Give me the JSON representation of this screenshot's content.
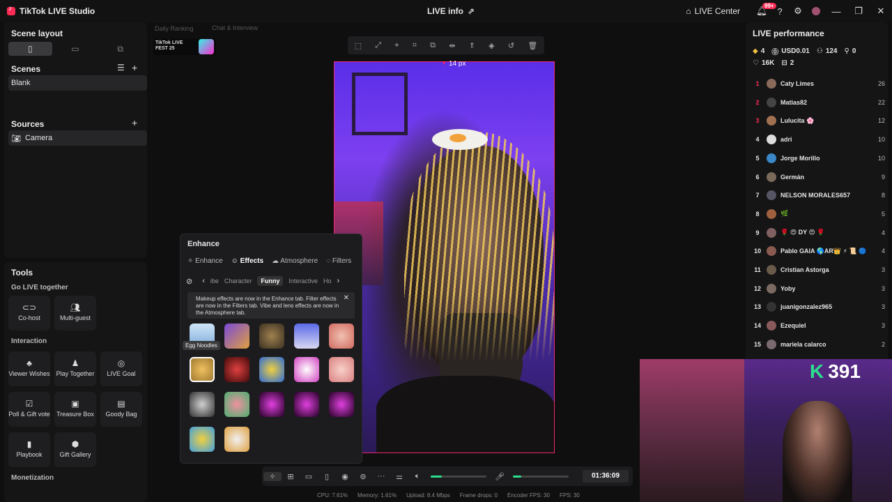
{
  "app": {
    "title": "TikTok LIVE Studio",
    "center_title": "LIVE info",
    "live_center_label": "LIVE Center",
    "notification_badge": "99+"
  },
  "left": {
    "scene_layout_label": "Scene layout",
    "scenes_label": "Scenes",
    "scenes": [
      "Blank"
    ],
    "sources_label": "Sources",
    "sources": [
      "Camera"
    ]
  },
  "tools": {
    "title": "Tools",
    "go_live_together": "Go LIVE together",
    "cohost": "Co-host",
    "multiguest": "Multi-guest",
    "interaction": "Interaction",
    "viewer_wishes": "Viewer Wishes",
    "play_together": "Play Together",
    "live_goal": "LIVE Goal",
    "poll_gift": "Poll & Gift vote",
    "treasure_box": "Treasure Box",
    "goody_bag": "Goody Bag",
    "playbook": "Playbook",
    "gift_gallery": "Gift Gallery",
    "monetization": "Monetization"
  },
  "stage": {
    "overlay_daily": "Daily Ranking",
    "overlay_chat": "Chat & Interview",
    "fest_logo": "TikTok LIVE FEST 25",
    "px_label": "14 px"
  },
  "effects": {
    "title": "Enhance",
    "tabs": [
      "Enhance",
      "Effects",
      "Atmosphere",
      "Filters"
    ],
    "categories": [
      "ibe",
      "Character",
      "Funny",
      "Interactive",
      "Ho"
    ],
    "notice": "Makeup effects are now in the Enhance tab. Filter effects are now in the Filters tab. Vibe and lens effects are now in the Atmosphere tab.",
    "tooltip": "Egg Noodles"
  },
  "bottom": {
    "timer": "01:36:09",
    "mic_level": 0.15,
    "volume_level": 0.2,
    "cpu": "CPU: 7.61%",
    "memory": "Memory: 1.61%",
    "upload": "Upload: 8.4 Mbps",
    "frame_drops": "Frame drops: 0",
    "encoder_fps": "Encoder FPS: 30",
    "fps": "FPS: 30"
  },
  "performance": {
    "title": "LIVE performance",
    "diamonds": "4",
    "usd": "USD0.01",
    "viewers": "124",
    "new_followers": "0",
    "likes": "16K",
    "gifters": "2",
    "ranking": [
      {
        "n": "1",
        "name": "Caty Limes",
        "score": "26",
        "color": "#8a6a5a"
      },
      {
        "n": "2",
        "name": "Matias82",
        "score": "22",
        "color": "#444"
      },
      {
        "n": "3",
        "name": "Lulucita 🌸",
        "score": "12",
        "color": "#a07050"
      },
      {
        "n": "4",
        "name": "adri",
        "score": "10",
        "color": "#ddd"
      },
      {
        "n": "5",
        "name": "Jorge Morillo",
        "score": "10",
        "color": "#3a88c8"
      },
      {
        "n": "6",
        "name": "Germán",
        "score": "9",
        "color": "#7a6a5a"
      },
      {
        "n": "7",
        "name": "NELSON MORALES657",
        "score": "8",
        "color": "#556"
      },
      {
        "n": "8",
        "name": "🌿",
        "score": "5",
        "color": "#a06040"
      },
      {
        "n": "9",
        "name": "🌹 😍 DY 😍 🌹",
        "score": "4",
        "color": "#806060"
      },
      {
        "n": "10",
        "name": "Pablo GAIA 🌎AR👑 ⚡ 📜 🔵",
        "score": "4",
        "color": "#8a5a50"
      },
      {
        "n": "11",
        "name": "Cristian Astorga",
        "score": "3",
        "color": "#6a5a4a"
      },
      {
        "n": "12",
        "name": "Yoby",
        "score": "3",
        "color": "#7a6a60"
      },
      {
        "n": "13",
        "name": "juanigonzalez965",
        "score": "3",
        "color": "#333"
      },
      {
        "n": "14",
        "name": "Ezequiel",
        "score": "3",
        "color": "#8a5a5a"
      },
      {
        "n": "15",
        "name": "mariela calarco",
        "score": "2",
        "color": "#7a6a70"
      }
    ]
  },
  "pip": {
    "badge_k": "K",
    "badge_num": "391"
  },
  "colors": {
    "accent": "#fe2c55",
    "border_pink": "#f0266f",
    "green": "#2be08e"
  }
}
